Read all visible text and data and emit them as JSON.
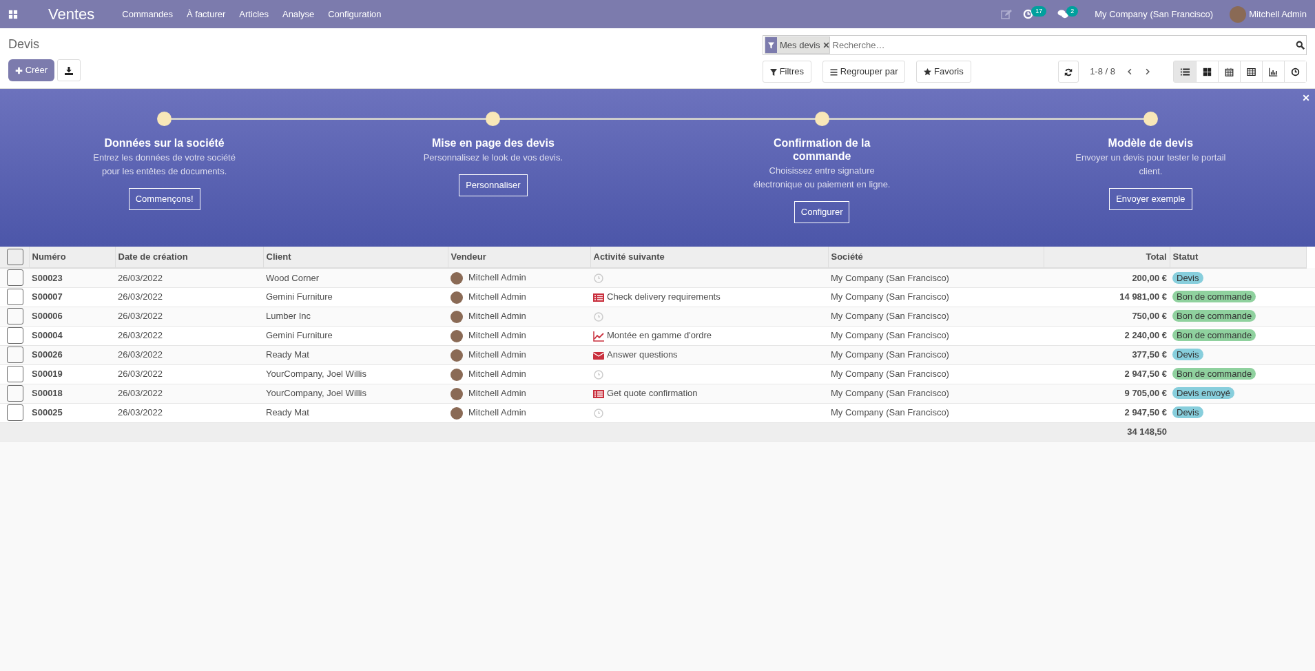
{
  "navbar": {
    "app": "Ventes",
    "menu": [
      "Commandes",
      "À facturer",
      "Articles",
      "Analyse",
      "Configuration"
    ],
    "activity_count": "17",
    "message_count": "2",
    "company": "My Company (San Francisco)",
    "user": "Mitchell Admin"
  },
  "control_panel": {
    "title": "Devis",
    "create_button": "Créer",
    "facet": "Mes devis",
    "search_placeholder": "Recherche…",
    "filters": "Filtres",
    "group_by": "Regrouper par",
    "favorites": "Favoris",
    "pager": "1-8 / 8",
    "views": [
      {
        "kind": "list",
        "selected": true
      },
      {
        "kind": "kanban",
        "selected": false
      },
      {
        "kind": "calendar",
        "selected": false
      },
      {
        "kind": "pivot",
        "selected": false
      },
      {
        "kind": "graph",
        "selected": false
      },
      {
        "kind": "activity",
        "selected": false
      }
    ]
  },
  "onboarding": [
    {
      "title": "Données sur la société",
      "text": "Entrez les données de votre société pour les entêtes de documents.",
      "button": "Commençons!"
    },
    {
      "title": "Mise en page des devis",
      "text": "Personnalisez le look de vos devis.",
      "button": "Personnaliser"
    },
    {
      "title": "Confirmation de la commande",
      "text": "Choisissez entre signature électronique ou paiement en ligne.",
      "button": "Configurer"
    },
    {
      "title": "Modèle de devis",
      "text": "Envoyer un devis pour tester le portail client.",
      "button": "Envoyer exemple"
    }
  ],
  "table": {
    "select_all_checked": false,
    "columns": [
      "Numéro",
      "Date de création",
      "Client",
      "Vendeur",
      "Activité suivante",
      "Société",
      "Total",
      "Statut"
    ],
    "rows": [
      {
        "number": "S00023",
        "date": "26/03/2022",
        "client": "Wood Corner",
        "salesperson": "Mitchell Admin",
        "activity": {
          "kind": "none"
        },
        "company": "My Company (San Francisco)",
        "total": "200,00 €",
        "status": {
          "label": "Devis",
          "color": "#87cedc"
        },
        "checked": false
      },
      {
        "number": "S00007",
        "date": "26/03/2022",
        "client": "Gemini Furniture",
        "salesperson": "Mitchell Admin",
        "activity": {
          "kind": "todo",
          "text": "Check delivery requirements"
        },
        "company": "My Company (San Francisco)",
        "total": "14 981,00 €",
        "status": {
          "label": "Bon de commande",
          "color": "#8fd19e"
        },
        "checked": false
      },
      {
        "number": "S00006",
        "date": "26/03/2022",
        "client": "Lumber Inc",
        "salesperson": "Mitchell Admin",
        "activity": {
          "kind": "none"
        },
        "company": "My Company (San Francisco)",
        "total": "750,00 €",
        "status": {
          "label": "Bon de commande",
          "color": "#8fd19e"
        },
        "checked": false
      },
      {
        "number": "S00004",
        "date": "26/03/2022",
        "client": "Gemini Furniture",
        "salesperson": "Mitchell Admin",
        "activity": {
          "kind": "upsell",
          "text": "Montée en gamme d'ordre"
        },
        "company": "My Company (San Francisco)",
        "total": "2 240,00 €",
        "status": {
          "label": "Bon de commande",
          "color": "#8fd19e"
        },
        "checked": false
      },
      {
        "number": "S00026",
        "date": "26/03/2022",
        "client": "Ready Mat",
        "salesperson": "Mitchell Admin",
        "activity": {
          "kind": "email",
          "text": "Answer questions"
        },
        "company": "My Company (San Francisco)",
        "total": "377,50 €",
        "status": {
          "label": "Devis",
          "color": "#87cedc"
        },
        "checked": false
      },
      {
        "number": "S00019",
        "date": "26/03/2022",
        "client": "YourCompany, Joel Willis",
        "salesperson": "Mitchell Admin",
        "activity": {
          "kind": "none"
        },
        "company": "My Company (San Francisco)",
        "total": "2 947,50 €",
        "status": {
          "label": "Bon de commande",
          "color": "#8fd19e"
        },
        "checked": false
      },
      {
        "number": "S00018",
        "date": "26/03/2022",
        "client": "YourCompany, Joel Willis",
        "salesperson": "Mitchell Admin",
        "activity": {
          "kind": "todo",
          "text": "Get quote confirmation"
        },
        "company": "My Company (San Francisco)",
        "total": "9 705,00 €",
        "status": {
          "label": "Devis envoyé",
          "color": "#87cedc"
        },
        "checked": false
      },
      {
        "number": "S00025",
        "date": "26/03/2022",
        "client": "Ready Mat",
        "salesperson": "Mitchell Admin",
        "activity": {
          "kind": "none"
        },
        "company": "My Company (San Francisco)",
        "total": "2 947,50 €",
        "status": {
          "label": "Devis",
          "color": "#87cedc"
        },
        "checked": false
      }
    ],
    "sum": "34 148,50"
  }
}
